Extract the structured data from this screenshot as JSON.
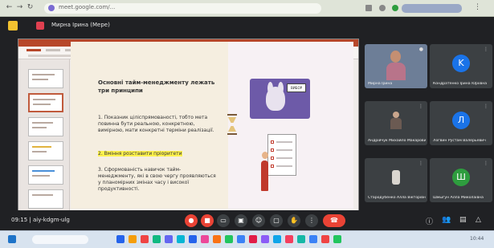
{
  "browser": {
    "url": "meet.google.com/...",
    "profile_label": ""
  },
  "meeting": {
    "title": "Мирна Ірина (Мере)",
    "code": "09:15 | aiy-kdgm-ulg"
  },
  "slide": {
    "title": "Основні тайм-менеджменту лежать три принципи",
    "point1": "1. Показник ціліспрямованості, тобто мета повинна бути реальною, конкретною, вимірною, мати конкретні терміни реалізації.",
    "point2": "2. Вміння розставити пріоритети",
    "point3": "3. Сформованість навичок тайм-менеджменту, які в свою чергу проявляються у планомірних змінах часу і високої продуктивності.",
    "sign_text": "ВИБОР"
  },
  "participants": [
    {
      "name": "Мирна Ірина",
      "initial": "",
      "color": "#6d7e97",
      "kind": "camera"
    },
    {
      "name": "Кондратенко Ірина Юріївна",
      "initial": "K",
      "color": "#1a73e8",
      "kind": "avatar"
    },
    {
      "name": "Андрійчук Михайло Макарович",
      "initial": "",
      "color": "#3c4043",
      "kind": "figure"
    },
    {
      "name": "Логвин Рустам Валерьевич",
      "initial": "Л",
      "color": "#1a73e8",
      "kind": "avatar"
    },
    {
      "name": "Стародубенко Алла Вікторівна",
      "initial": "",
      "color": "#3c4043",
      "kind": "figure"
    },
    {
      "name": "Шмыгун Алла Миколаївна",
      "initial": "Ш",
      "color": "#2e9d3e",
      "kind": "avatar"
    }
  ],
  "controls": {
    "mic_icon": "mic-off-icon",
    "camera_icon": "camera-off-icon",
    "present_icon": "present-icon",
    "captions_icon": "captions-icon",
    "reaction_icon": "emoji-icon",
    "hand_icon": "raise-hand-icon",
    "more_icon": "more-options-icon",
    "end_icon": "end-call-icon"
  },
  "taskbar": {
    "time": "10:44"
  }
}
